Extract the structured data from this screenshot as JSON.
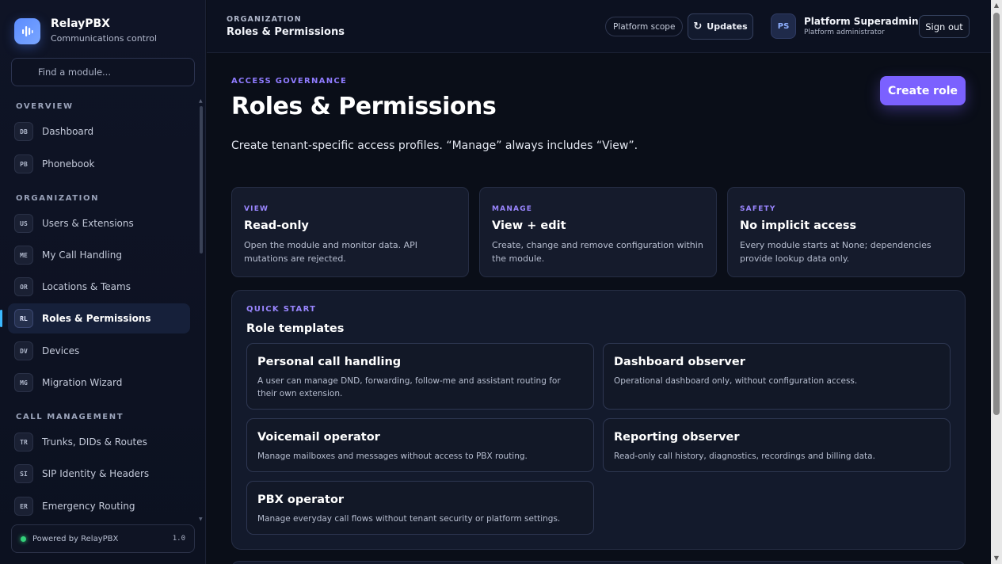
{
  "brand": {
    "name": "RelayPBX",
    "subtitle": "Communications control"
  },
  "search": {
    "placeholder": "Find a module..."
  },
  "nav": {
    "sections": {
      "overview": "OVERVIEW",
      "organization": "ORGANIZATION",
      "call_management": "CALL MANAGEMENT"
    },
    "items": [
      {
        "code": "DB",
        "label": "Dashboard"
      },
      {
        "code": "PB",
        "label": "Phonebook"
      },
      {
        "code": "US",
        "label": "Users & Extensions"
      },
      {
        "code": "ME",
        "label": "My Call Handling"
      },
      {
        "code": "OR",
        "label": "Locations & Teams"
      },
      {
        "code": "RL",
        "label": "Roles & Permissions"
      },
      {
        "code": "DV",
        "label": "Devices"
      },
      {
        "code": "MG",
        "label": "Migration Wizard"
      },
      {
        "code": "TR",
        "label": "Trunks, DIDs & Routes"
      },
      {
        "code": "SI",
        "label": "SIP Identity & Headers"
      },
      {
        "code": "ER",
        "label": "Emergency Routing"
      }
    ],
    "active": "Roles & Permissions"
  },
  "footer": {
    "text": "Powered by RelayPBX",
    "version": "1.0"
  },
  "topbar": {
    "crumb_section": "ORGANIZATION",
    "crumb_title": "Roles & Permissions",
    "scope_chip": "Platform scope",
    "updates_label": "Updates",
    "avatar_initials": "PS",
    "user_name": "Platform Superadmin",
    "user_role": "Platform administrator",
    "signout_label": "Sign out"
  },
  "page": {
    "eyebrow": "ACCESS GOVERNANCE",
    "title": "Roles & Permissions",
    "description": "Create tenant-specific access profiles. “Manage” always includes “View”.",
    "create_button": "Create role"
  },
  "info_cards": [
    {
      "eyebrow": "VIEW",
      "title": "Read-only",
      "desc": "Open the module and monitor data. API mutations are rejected."
    },
    {
      "eyebrow": "MANAGE",
      "title": "View + edit",
      "desc": "Create, change and remove configuration within the module."
    },
    {
      "eyebrow": "SAFETY",
      "title": "No implicit access",
      "desc": "Every module starts at None; dependencies provide lookup data only."
    }
  ],
  "quick_start": {
    "eyebrow": "QUICK START",
    "title": "Role templates",
    "templates": [
      {
        "title": "Personal call handling",
        "desc": "A user can manage DND, forwarding, follow-me and assistant routing for their own extension."
      },
      {
        "title": "Dashboard observer",
        "desc": "Operational dashboard only, without configuration access."
      },
      {
        "title": "Voicemail operator",
        "desc": "Manage mailboxes and messages without access to PBX routing."
      },
      {
        "title": "Reporting observer",
        "desc": "Read-only call history, diagnostics, recordings and billing data."
      },
      {
        "title": "PBX operator",
        "desc": "Manage everyday call flows without tenant security or platform settings."
      }
    ]
  },
  "colors": {
    "accent": "#7b61ff",
    "active_indicator": "#3bb9ff",
    "status_online": "#33d17a"
  }
}
